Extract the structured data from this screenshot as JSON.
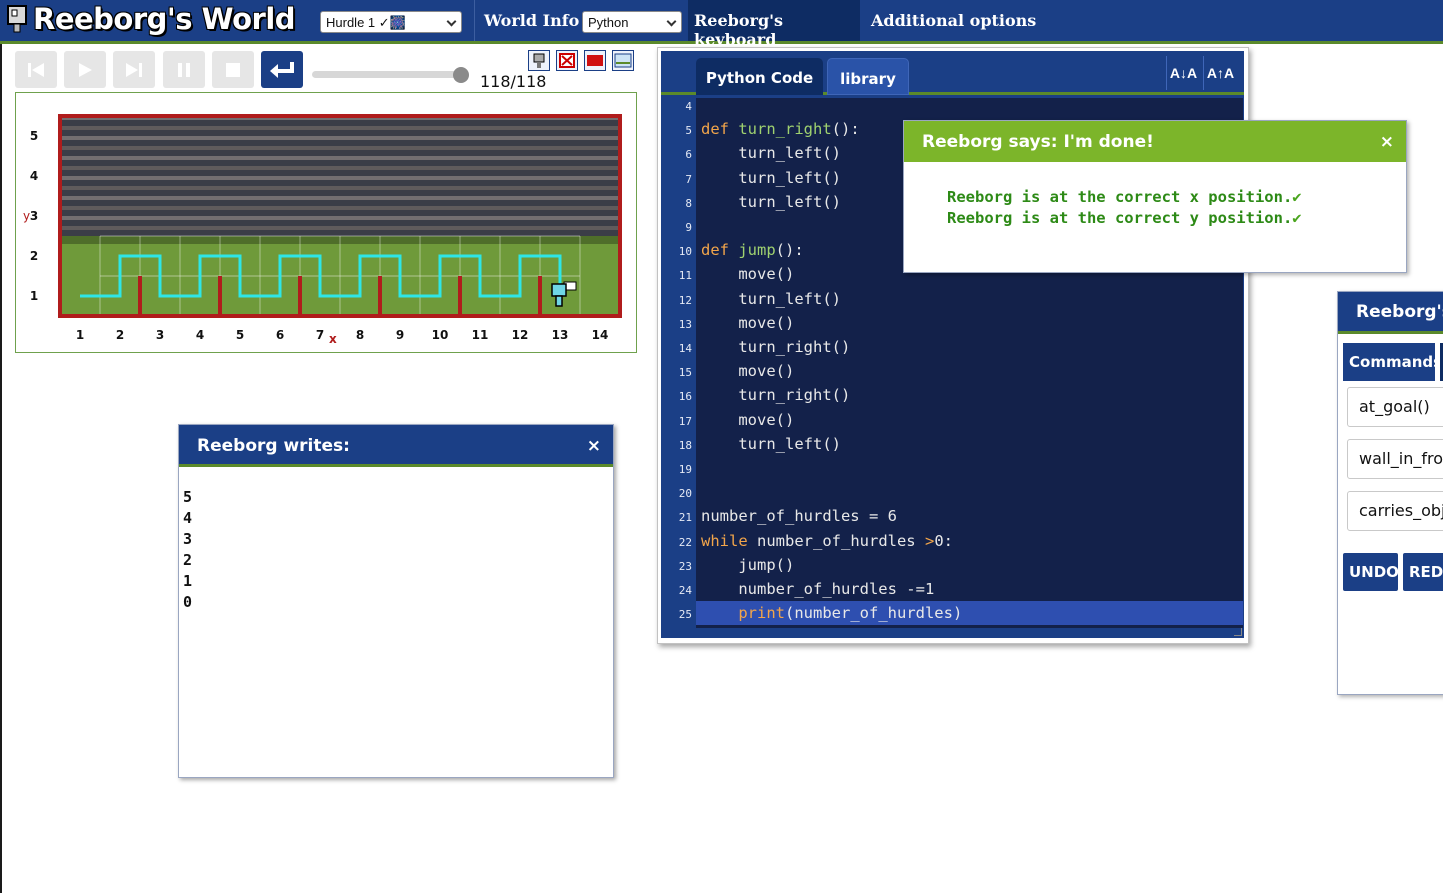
{
  "topbar": {
    "title": "Reeborg's World",
    "world_select": "Hurdle 1 ✓🎆",
    "world_info": "World Info",
    "language_select": "Python",
    "keyboard": "Reeborg's keyboard",
    "additional_options": "Additional options"
  },
  "controls": {
    "step_counter": "118/118",
    "speed_fraction": 1.0
  },
  "world": {
    "y_axis_label": "y",
    "x_axis_label": "x",
    "x_ticks": [
      "1",
      "2",
      "3",
      "4",
      "5",
      "6",
      "7",
      "8",
      "9",
      "10",
      "11",
      "12",
      "13",
      "14"
    ],
    "y_ticks": [
      "5",
      "4",
      "3",
      "2",
      "1"
    ],
    "background": "stadium photo"
  },
  "writes_dialog": {
    "title": "Reeborg writes:",
    "close": "×",
    "lines": [
      "5",
      "4",
      "3",
      "2",
      "1",
      "0"
    ]
  },
  "editor": {
    "tab_python": "Python Code",
    "tab_library": "library",
    "font_decrease": "A↓A",
    "font_increase": "A↑A",
    "line_numbers": [
      "4",
      "5",
      "6",
      "7",
      "8",
      "9",
      "10",
      "11",
      "12",
      "13",
      "14",
      "15",
      "16",
      "17",
      "18",
      "19",
      "20",
      "21",
      "22",
      "23",
      "24",
      "25"
    ],
    "code": [
      "",
      "def turn_right():",
      "    turn_left()",
      "    turn_left()",
      "    turn_left()",
      "",
      "def jump():",
      "    move()",
      "    turn_left()",
      "    move()",
      "    turn_right()",
      "    move()",
      "    turn_right()",
      "    move()",
      "    turn_left()",
      "",
      "",
      "number_of_hurdles = 6",
      "while number_of_hurdles >0:",
      "    jump()",
      "    number_of_hurdles -=1",
      "    print(number_of_hurdles)"
    ],
    "highlighted_line": "25"
  },
  "done_dialog": {
    "title": "Reeborg says: I'm done!",
    "close": "×",
    "lines": [
      "Reeborg is at the correct x position.",
      "Reeborg is at the correct y position."
    ],
    "check": "✔"
  },
  "keyboard_panel": {
    "title": "Reeborg's keyboard",
    "tab_commands": "Commands",
    "keys": [
      "at_goal()",
      "wall_in_front()",
      "carries_object()"
    ],
    "undo": "UNDO",
    "redo": "REDO"
  },
  "colors": {
    "brand_blue": "#1b3f86",
    "accent_green": "#5b8a2b",
    "trace": "#2ee6e6",
    "wall": "#b01c1c",
    "editor_bg": "#13214a"
  }
}
